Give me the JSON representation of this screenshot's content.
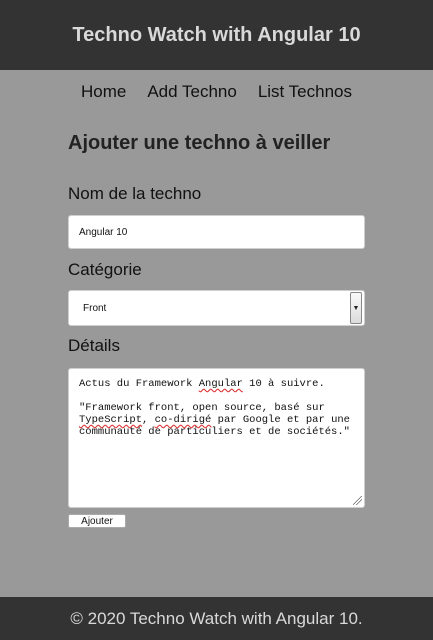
{
  "header": {
    "title": "Techno Watch with Angular 10"
  },
  "nav": {
    "home": "Home",
    "add": "Add Techno",
    "list": "List Technos"
  },
  "form": {
    "title": "Ajouter une techno à veiller",
    "name_label": "Nom de la techno",
    "name_value": "Angular 10",
    "category_label": "Catégorie",
    "category_value": "Front",
    "details_label": "Détails",
    "details_line1_a": "Actus du Framework ",
    "details_line1_spell": "Angular",
    "details_line1_b": " 10 à suivre.",
    "details_line2_a": "\"Framework front, open source, basé sur ",
    "details_line2_spell1": "TypeScript",
    "details_line2_b": ", ",
    "details_line2_spell2": "co-dirigé",
    "details_line2_c": " par Google et par une communauté de particuliers et de sociétés.\"",
    "submit_label": "Ajouter"
  },
  "footer": {
    "text": "© 2020 Techno Watch with Angular 10."
  },
  "colors": {
    "header_bg": "#333333",
    "page_bg": "#999999",
    "header_text": "#d9d9d9"
  }
}
